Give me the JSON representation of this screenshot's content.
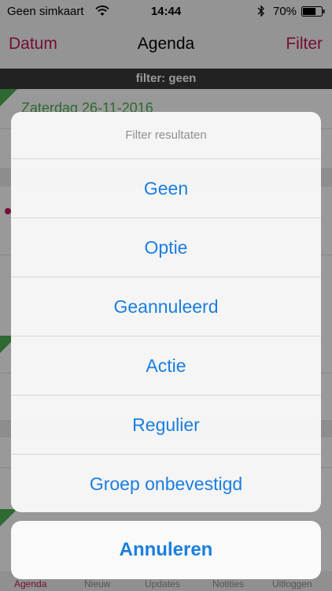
{
  "status_bar": {
    "carrier": "Geen simkaart",
    "time": "14:44",
    "battery_percent": "70%",
    "battery_level": 0.7
  },
  "nav": {
    "left_label": "Datum",
    "title": "Agenda",
    "right_label": "Filter"
  },
  "filter_strip": "filter: geen",
  "content": {
    "date_heading": "Zaterdag 26-11-2016"
  },
  "action_sheet": {
    "title": "Filter resultaten",
    "options": [
      "Geen",
      "Optie",
      "Geannuleerd",
      "Actie",
      "Regulier",
      "Groep onbevestigd"
    ],
    "cancel_label": "Annuleren"
  },
  "tabs": [
    {
      "label": "Agenda",
      "active": true
    },
    {
      "label": "Nieuw",
      "active": false
    },
    {
      "label": "Updates",
      "active": false
    },
    {
      "label": "Notities",
      "active": false
    },
    {
      "label": "Uitloggen",
      "active": false
    }
  ],
  "colors": {
    "accent": "#c2185b",
    "action": "#1a7ee0",
    "date_green": "#4caf50"
  }
}
